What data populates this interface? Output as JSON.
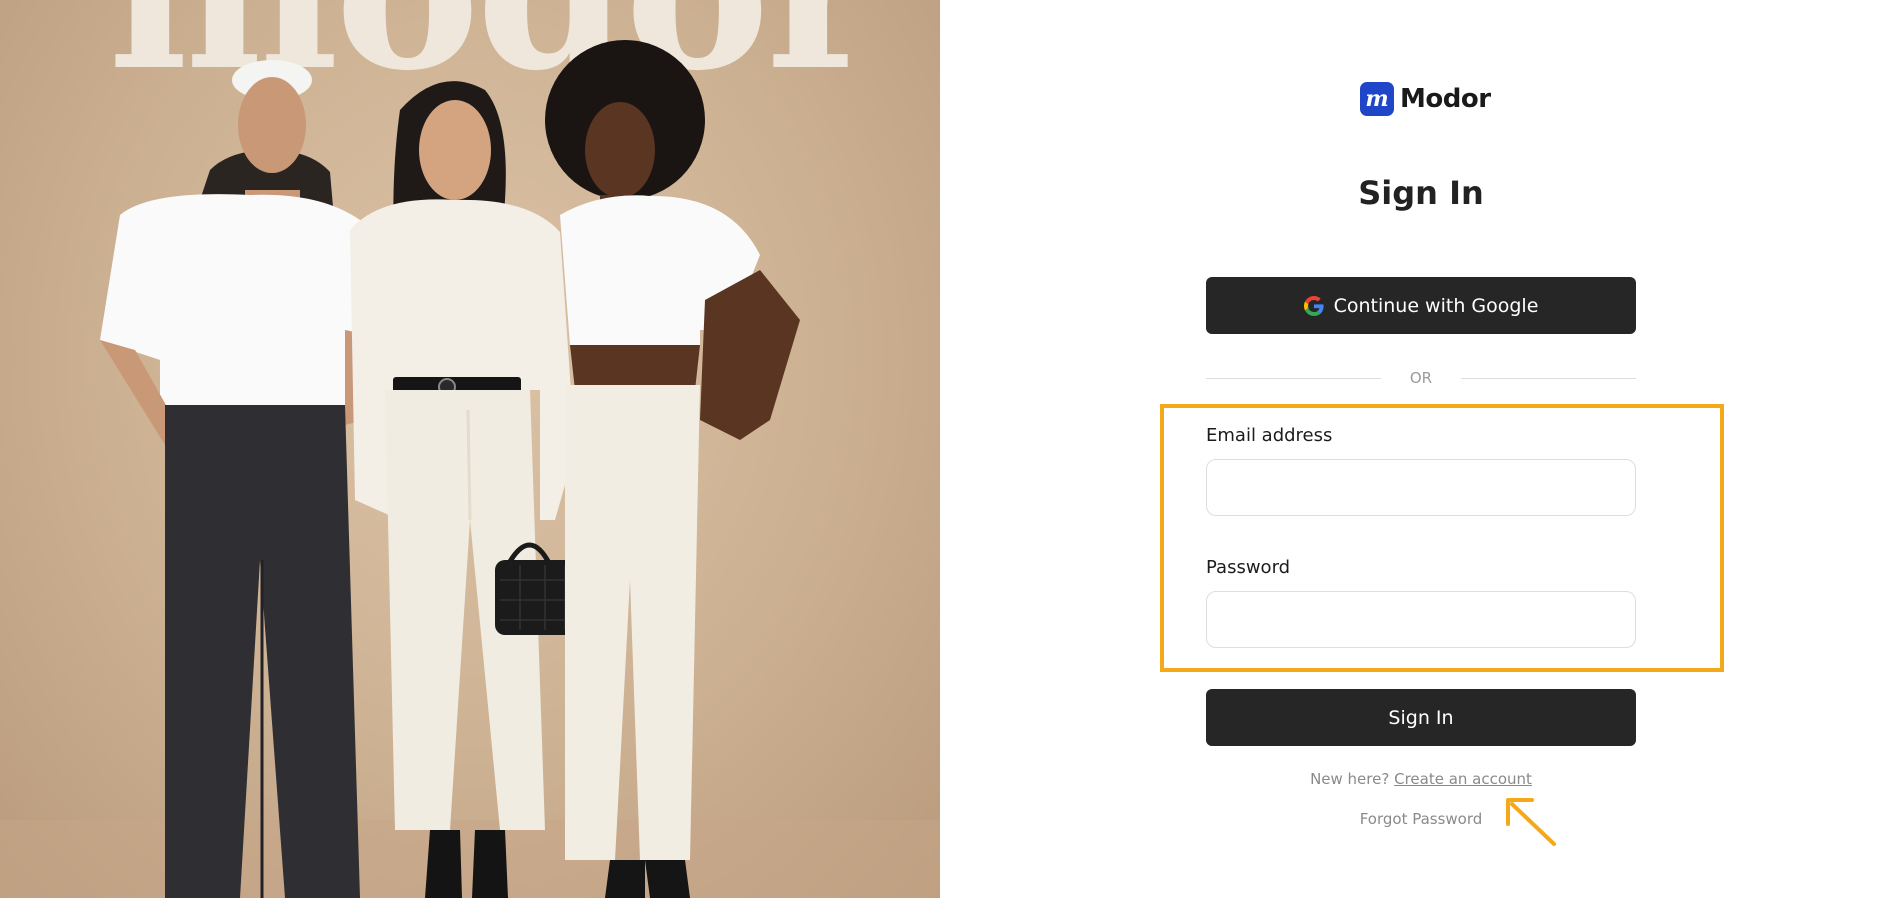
{
  "hero": {
    "brand_word": "modor"
  },
  "logo": {
    "mark": "m",
    "name": "Modor",
    "color": "#1f46c9"
  },
  "form": {
    "title": "Sign In",
    "google_button_label": "Continue with Google",
    "divider_text": "OR",
    "email_label": "Email address",
    "email_value": "",
    "password_label": "Password",
    "password_value": "",
    "submit_label": "Sign In",
    "new_here_text": "New here?",
    "create_account_link": "Create an account",
    "forgot_password_link": "Forgot Password"
  },
  "icons": {
    "google": "google-g-icon",
    "annotation_arrow": "arrow-icon"
  },
  "colors": {
    "button_bg": "#262626",
    "highlight": "#f5a91a",
    "muted_text": "#8a8a8a"
  }
}
